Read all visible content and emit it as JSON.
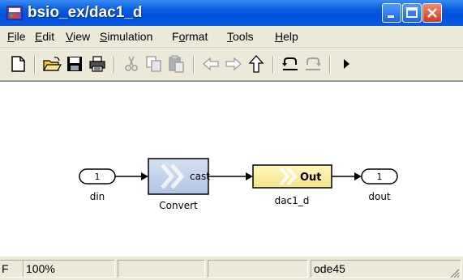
{
  "window": {
    "title": "bsio_ex/dac1_d"
  },
  "menu": {
    "items": [
      {
        "label": "File",
        "accel": "F",
        "rest": "ile"
      },
      {
        "label": "Edit",
        "accel": "E",
        "rest": "dit"
      },
      {
        "label": "View",
        "accel": "V",
        "rest": "iew"
      },
      {
        "label": "Simulation",
        "accel": "S",
        "rest": "imulation"
      },
      {
        "label": "Format",
        "pre": "F",
        "accel": "o",
        "rest": "rmat"
      },
      {
        "label": "Tools",
        "accel": "T",
        "rest": "ools"
      },
      {
        "label": "Help",
        "accel": "H",
        "rest": "elp"
      }
    ]
  },
  "toolbar": {
    "icons": [
      "new-icon",
      "open-icon",
      "save-icon",
      "print-icon",
      "cut-icon",
      "copy-icon",
      "paste-icon",
      "back-icon",
      "forward-icon",
      "up-icon",
      "undo-icon",
      "redo-icon",
      "start-simulation-icon"
    ]
  },
  "model": {
    "inport": {
      "number": "1",
      "label": "din"
    },
    "convert": {
      "text": "cast",
      "label": "Convert"
    },
    "subsystem": {
      "text": "Out",
      "label": "dac1_d"
    },
    "outport": {
      "number": "1",
      "label": "dout"
    }
  },
  "status": {
    "left_char": "F",
    "zoom": "100%",
    "solver": "ode45"
  },
  "colors": {
    "titlebar": "#0a5fe0",
    "convert_fill": "#c3d3ea",
    "subsystem_fill": "#fff3a8",
    "chrome": "#ece9d8"
  }
}
